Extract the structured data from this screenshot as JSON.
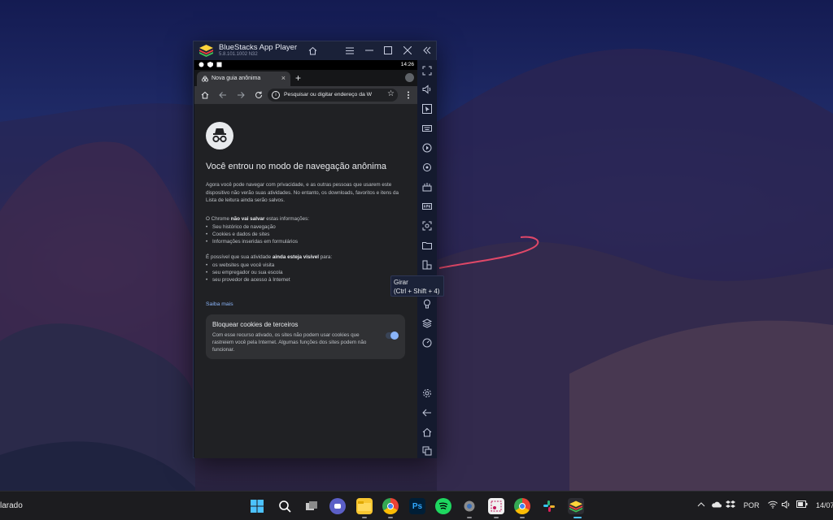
{
  "window": {
    "app_title": "BlueStacks App Player",
    "version": "5.8.101.1002  N32"
  },
  "statusbar": {
    "time": "14:26"
  },
  "browser": {
    "tab_label": "Nova guia anônima",
    "close_symbol": "×",
    "new_tab_symbol": "+",
    "omnibox_placeholder": "Pesquisar ou digitar endereço da W",
    "incognito": {
      "heading": "Você entrou no modo de navegação anônima",
      "intro": "Agora você pode navegar com privacidade, e as outras pessoas que usarem este dispositivo não verão suas atividades. No entanto, os downloads, favoritos e itens da Lista de leitura ainda serão salvos.",
      "wont_save_prefix": "O Chrome ",
      "wont_save_bold": "não vai salvar",
      "wont_save_suffix": " estas informações:",
      "wont_save_items": [
        "Seu histórico de navegação",
        "Cookies e dados de sites",
        "Informações inseridas em formulários"
      ],
      "visible_prefix": "É possível que sua atividade ",
      "visible_bold": "ainda esteja visível",
      "visible_suffix": " para:",
      "visible_items": [
        "os websites que você visita",
        "seu empregador ou sua escola",
        "seu provedor de acesso à Internet"
      ],
      "learn_more": "Saiba mais",
      "cookie_card": {
        "title": "Bloquear cookies de terceiros",
        "description": "Com esse recurso ativado, os sites não podem usar cookies que rastreiem você pela Internet. Algumas funções dos sites podem não funcionar.",
        "toggle_on": true
      }
    }
  },
  "tooltip": {
    "title": "Girar",
    "shortcut": "(Ctrl + Shift + 4)"
  },
  "taskbar": {
    "left_text": "larado",
    "language": "POR",
    "date_partial": "14/07"
  },
  "colors": {
    "accent_link": "#8ab4f8",
    "chrome_bg": "#202124",
    "bluestacks_frame": "#141a2e"
  }
}
